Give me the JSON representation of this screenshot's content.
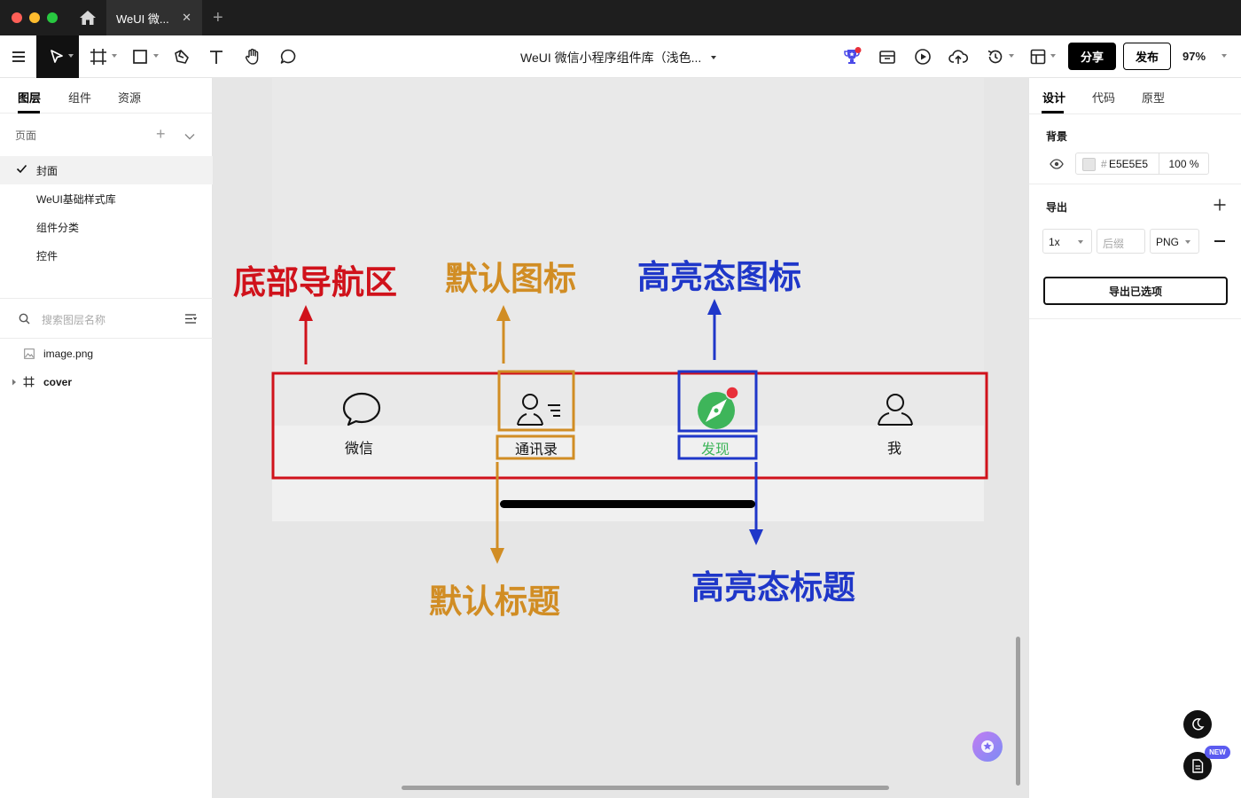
{
  "window": {
    "tab_title": "WeUI 微...",
    "tab_close": "✕",
    "new_tab": "+"
  },
  "toolbar": {
    "doc_title": "WeUI 微信小程序组件库（浅色...",
    "share_label": "分享",
    "publish_label": "发布",
    "zoom": "97%"
  },
  "left_panel": {
    "tabs": [
      "图层",
      "组件",
      "资源"
    ],
    "pages_header": "页面",
    "pages": [
      "封面",
      "WeUI基础样式库",
      "组件分类",
      "控件"
    ],
    "search_placeholder": "搜索图层名称",
    "layers": [
      "image.png",
      "cover"
    ]
  },
  "canvas": {
    "annotations": {
      "bottom_nav": "底部导航区",
      "default_icon": "默认图标",
      "highlight_icon": "高亮态图标",
      "default_title": "默认标题",
      "highlight_title": "高亮态标题"
    },
    "tabbar": [
      "微信",
      "通讯录",
      "发现",
      "我"
    ]
  },
  "right_panel": {
    "tabs": [
      "设计",
      "代码",
      "原型"
    ],
    "background_label": "背景",
    "bg_hash": "#",
    "bg_hex": "E5E5E5",
    "bg_opacity": "100 %",
    "export_label": "导出",
    "export_scale": "1x",
    "export_suffix_placeholder": "后缀",
    "export_format": "PNG",
    "export_button": "导出已选项",
    "new_badge": "NEW"
  },
  "colors": {
    "annot_red": "#d0121b",
    "annot_orange": "#d18d24",
    "annot_blue": "#1f37c9",
    "wechat_green": "#3eb55a"
  }
}
